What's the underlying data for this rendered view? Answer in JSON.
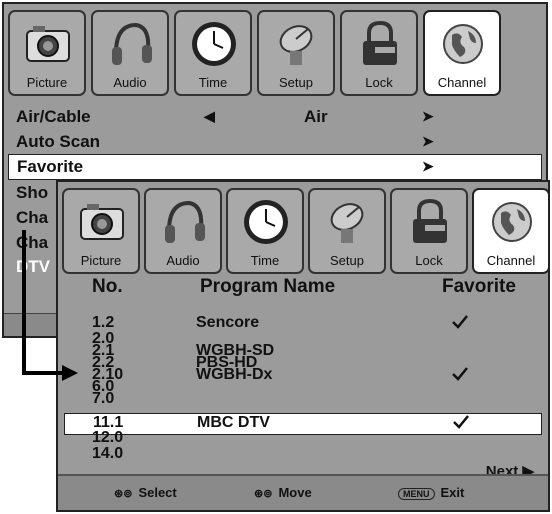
{
  "tabs": [
    {
      "label": "Picture",
      "icon": "camera-icon"
    },
    {
      "label": "Audio",
      "icon": "headphones-icon"
    },
    {
      "label": "Time",
      "icon": "clock-icon"
    },
    {
      "label": "Setup",
      "icon": "satellite-dish-icon"
    },
    {
      "label": "Lock",
      "icon": "padlock-icon"
    },
    {
      "label": "Channel",
      "icon": "globe-icon"
    }
  ],
  "back_menu": {
    "rows": [
      {
        "label": "Air/Cable",
        "value": "Air"
      },
      {
        "label": "Auto Scan"
      },
      {
        "label": "Favorite"
      }
    ],
    "covered": [
      "Sho",
      "Cha",
      "Cha",
      "DTV"
    ]
  },
  "front_menu": {
    "headers": {
      "no": "No.",
      "name": "Program Name",
      "fav": "Favorite"
    },
    "rows": [
      {
        "no": "1.2",
        "name": "Sencore",
        "fav": true
      },
      {
        "no": "2.0",
        "name": "",
        "fav": false
      },
      {
        "no": "2.1",
        "name": "WGBH-SD",
        "fav": false
      },
      {
        "no": "2.2",
        "name": "PBS-HD",
        "fav": false
      },
      {
        "no": "2.10",
        "name": "WGBH-Dx",
        "fav": true
      },
      {
        "no": "6.0",
        "name": "",
        "fav": false
      },
      {
        "no": "7.0",
        "name": "",
        "fav": false
      },
      {
        "no": "11.1",
        "name": "MBC DTV",
        "fav": true
      },
      {
        "no": "12.0",
        "name": "",
        "fav": false
      },
      {
        "no": "14.0",
        "name": "",
        "fav": false
      }
    ],
    "next_label": "Next",
    "footer": {
      "select": "Select",
      "move": "Move",
      "menu_key": "MENU",
      "exit": "Exit"
    }
  }
}
